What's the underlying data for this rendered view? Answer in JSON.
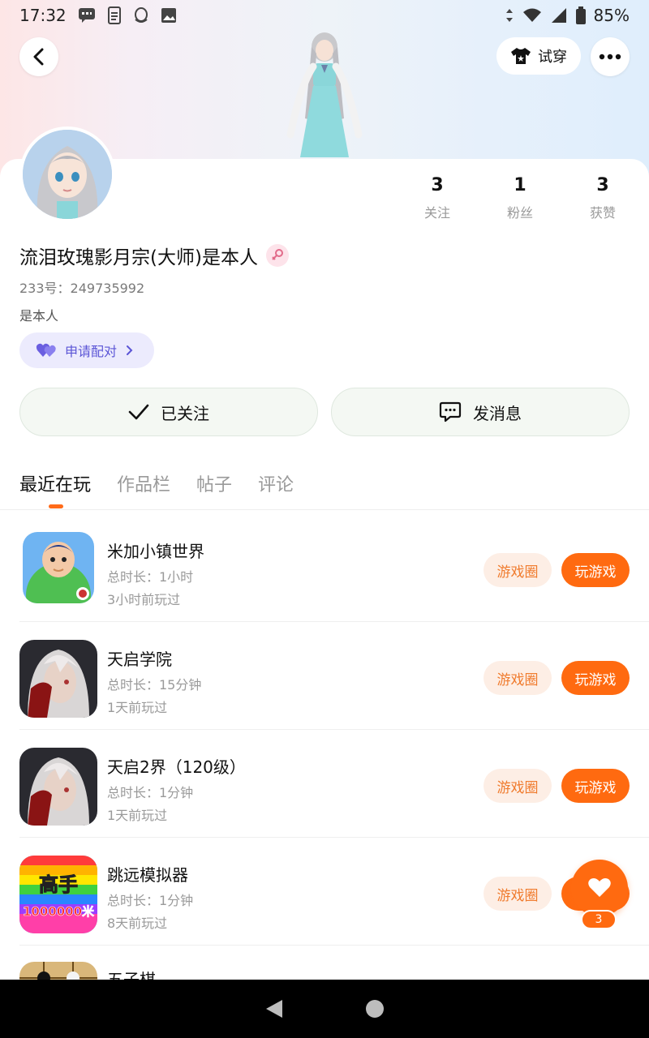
{
  "status_bar": {
    "time": "17:32",
    "battery": "85%",
    "left_icons": [
      "message-icon",
      "document-icon",
      "qq-icon",
      "image-icon"
    ],
    "right_icons": [
      "data-arrows-icon",
      "wifi-icon",
      "signal-icon",
      "battery-icon"
    ]
  },
  "header": {
    "back_icon": "back-chevron-icon",
    "tryon_label": "试穿",
    "more_icon": "more-dots-icon"
  },
  "profile": {
    "username": "流泪玫瑰影月宗(大师)是本人",
    "gender": "female",
    "uid": "233号：249735992",
    "bio": "是本人",
    "match_label": "申请配对",
    "stats": [
      {
        "value": "3",
        "label": "关注"
      },
      {
        "value": "1",
        "label": "粉丝"
      },
      {
        "value": "3",
        "label": "获赞"
      }
    ]
  },
  "actions": {
    "follow_label": "已关注",
    "message_label": "发消息"
  },
  "tabs": [
    {
      "label": "最近在玩",
      "active": true
    },
    {
      "label": "作品栏",
      "active": false
    },
    {
      "label": "帖子",
      "active": false
    },
    {
      "label": "评论",
      "active": false
    }
  ],
  "games": [
    {
      "name": "米加小镇世界",
      "duration": "总时长：1小时",
      "last_played": "3小时前玩过",
      "circle_label": "游戏圈",
      "play_label": "玩游戏"
    },
    {
      "name": "天启学院",
      "duration": "总时长：15分钟",
      "last_played": "1天前玩过",
      "circle_label": "游戏圈",
      "play_label": "玩游戏"
    },
    {
      "name": "天启2界（120级）",
      "duration": "总时长：1分钟",
      "last_played": "1天前玩过",
      "circle_label": "游戏圈",
      "play_label": "玩游戏"
    },
    {
      "name": "跳远模拟器",
      "duration": "总时长：1分钟",
      "last_played": "8天前玩过",
      "circle_label": "游戏圈",
      "play_label": "玩游戏"
    },
    {
      "name": "五子棋",
      "duration": "",
      "last_played": "",
      "circle_label": "",
      "play_label": ""
    }
  ],
  "game_icon_texts": {
    "jump_top": "高手",
    "jump_bottom": "1000000米"
  },
  "fab": {
    "count": "3"
  },
  "colors": {
    "accent": "#ff6a10",
    "accent_light": "#fdeee5",
    "match_bg": "#ecebfd",
    "match_text": "#5b55d6"
  }
}
